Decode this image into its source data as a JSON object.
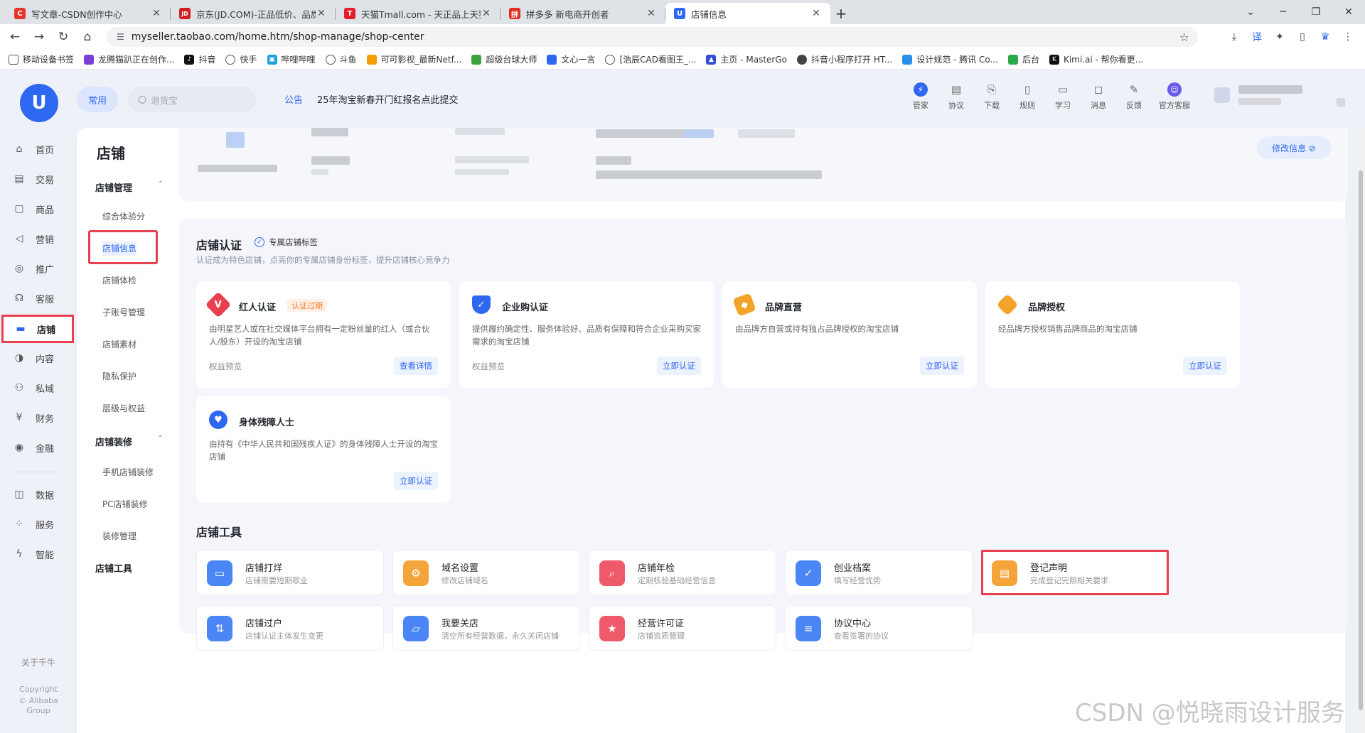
{
  "browser": {
    "tabs": [
      {
        "title": "写文章-CSDN创作中心",
        "fav": "C",
        "color": "#e8352b"
      },
      {
        "title": "京东(JD.COM)-正品低价、品质",
        "fav": "JD",
        "color": "#d01d1d"
      },
      {
        "title": "天猫Tmall.com - 天正品上天猫",
        "fav": "T",
        "color": "#e51c2a"
      },
      {
        "title": "拼多多 新电商开创者",
        "fav": "拼",
        "color": "#e02e24"
      },
      {
        "title": "店铺信息",
        "fav": "U",
        "color": "#2f68f0"
      }
    ],
    "url": "myseller.taobao.com/home.htm/shop-manage/shop-center",
    "bookmarks": [
      {
        "label": "移动设备书签",
        "color": "#666"
      },
      {
        "label": "龙腾猫趴正在创作...",
        "color": "#7b3fd6"
      },
      {
        "label": "抖音",
        "color": "#111"
      },
      {
        "label": "快手",
        "color": "#666"
      },
      {
        "label": "哔哩哔哩",
        "color": "#1b9fe1"
      },
      {
        "label": "斗鱼",
        "color": "#666"
      },
      {
        "label": "可可影视_最新Netf...",
        "color": "#f5a000"
      },
      {
        "label": "超级台球大师",
        "color": "#3ca33c"
      },
      {
        "label": "文心一言",
        "color": "#2f68f0"
      },
      {
        "label": "[浩辰CAD看图王_...",
        "color": "#c0392b"
      },
      {
        "label": "主页 - MasterGo",
        "color": "#2f4fd6"
      },
      {
        "label": "抖音小程序打开 HT...",
        "color": "#444"
      },
      {
        "label": "设计规范 - 腾讯 Co...",
        "color": "#2a8de8"
      },
      {
        "label": "后台",
        "color": "#2aa84a"
      },
      {
        "label": "Kimi.ai - 帮你看更...",
        "color": "#111"
      }
    ]
  },
  "header": {
    "common_label": "常用",
    "search_placeholder": "退货宝",
    "notice_label": "公告",
    "notice_text": "25年淘宝新春开门红报名点此提交",
    "tools": [
      {
        "label": "管家",
        "icon": "bolt-icon"
      },
      {
        "label": "协议",
        "icon": "contract-icon"
      },
      {
        "label": "下载",
        "icon": "download-icon"
      },
      {
        "label": "规则",
        "icon": "rules-icon"
      },
      {
        "label": "学习",
        "icon": "study-icon"
      },
      {
        "label": "消息",
        "icon": "message-icon"
      },
      {
        "label": "反馈",
        "icon": "feedback-icon"
      },
      {
        "label": "官方客服",
        "icon": "service-icon"
      }
    ]
  },
  "leftnav": {
    "items": [
      {
        "label": "首页",
        "icon": "home-icon"
      },
      {
        "label": "交易",
        "icon": "trade-icon"
      },
      {
        "label": "商品",
        "icon": "goods-icon"
      },
      {
        "label": "营销",
        "icon": "marketing-icon"
      },
      {
        "label": "推广",
        "icon": "promotion-icon"
      },
      {
        "label": "客服",
        "icon": "customer-service-icon"
      },
      {
        "label": "店铺",
        "icon": "shop-icon"
      },
      {
        "label": "内容",
        "icon": "content-icon"
      },
      {
        "label": "私域",
        "icon": "private-domain-icon"
      },
      {
        "label": "财务",
        "icon": "finance-icon"
      },
      {
        "label": "金融",
        "icon": "finance-service-icon"
      },
      {
        "label": "数据",
        "icon": "data-icon"
      },
      {
        "label": "服务",
        "icon": "services-icon"
      },
      {
        "label": "智能",
        "icon": "smart-icon"
      }
    ],
    "active": "店铺",
    "about": "关于千牛",
    "copyright": "Copyright",
    "company": "© Alibaba",
    "group": "Group"
  },
  "subnav": {
    "title": "店铺",
    "group1": "店铺管理",
    "group1_items": [
      "综合体验分",
      "店铺信息",
      "店铺体检",
      "子账号管理",
      "店铺素材",
      "隐私保护",
      "层级与权益"
    ],
    "group2": "店铺装修",
    "group2_items": [
      "手机店铺装修",
      "PC店铺装修",
      "装修管理"
    ],
    "group3": "店铺工具",
    "active": "店铺信息"
  },
  "info": {
    "modify_label": "修改信息 ⊘"
  },
  "certification": {
    "title": "店铺认证",
    "tag_label": "专属店铺标签",
    "description": "认证成为特色店铺，点亮你的专属店铺身份标签，提升店铺核心竞争力",
    "cards": [
      {
        "title": "红人认证",
        "badge": "认证过期",
        "desc": "由明星艺人或在社交媒体平台拥有一定粉丝量的红人（或合伙人/股东）开设的淘宝店铺",
        "foot": "权益预览",
        "button": "查看详情",
        "icon": "red-influencer-icon",
        "color": "#e8404f"
      },
      {
        "title": "企业购认证",
        "badge": "",
        "desc": "提供履约确定性、服务体验好、品质有保障和符合企业采购买家需求的淘宝店铺",
        "foot": "权益预览",
        "button": "立即认证",
        "icon": "enterprise-shield-icon",
        "color": "#2f68f0"
      },
      {
        "title": "品牌直营",
        "badge": "",
        "desc": "由品牌方自营或持有独占品牌授权的淘宝店铺",
        "foot": "",
        "button": "立即认证",
        "icon": "brand-tag-icon",
        "color": "#f4a32a"
      },
      {
        "title": "品牌授权",
        "badge": "",
        "desc": "经品牌方授权销售品牌商品的淘宝店铺",
        "foot": "",
        "button": "立即认证",
        "icon": "brand-diamond-icon",
        "color": "#f4a32a"
      },
      {
        "title": "身体残障人士",
        "badge": "",
        "desc": "由持有《中华人民共和国残疾人证》的身体残障人士开设的淘宝店铺",
        "foot": "",
        "button": "立即认证",
        "icon": "heart-hand-icon",
        "color": "#2f68f0"
      }
    ]
  },
  "tools": {
    "title": "店铺工具",
    "items": [
      {
        "name": "店铺打烊",
        "desc": "店铺需要短期歇业",
        "icon": "shop-closed-icon",
        "color": "#4a86f5"
      },
      {
        "name": "域名设置",
        "desc": "修改店铺域名",
        "icon": "domain-icon",
        "color": "#f5a43a"
      },
      {
        "name": "店铺年检",
        "desc": "定期核验基础经营信息",
        "icon": "annual-inspection-icon",
        "color": "#ee5a6a"
      },
      {
        "name": "创业档案",
        "desc": "填写经营优势",
        "icon": "archive-icon",
        "color": "#4a86f5"
      },
      {
        "name": "登记声明",
        "desc": "完成登记完照相关要求",
        "icon": "registration-icon",
        "color": "#f5a43a"
      },
      {
        "name": "店铺过户",
        "desc": "店铺认证主体发生变更",
        "icon": "transfer-icon",
        "color": "#4a86f5"
      },
      {
        "name": "我要关店",
        "desc": "清空所有经营数据，永久关闭店铺",
        "icon": "close-shop-icon",
        "color": "#4a86f5"
      },
      {
        "name": "经营许可证",
        "desc": "店铺资质管理",
        "icon": "license-icon",
        "color": "#ee5a6a"
      },
      {
        "name": "协议中心",
        "desc": "查看签署的协议",
        "icon": "agreement-icon",
        "color": "#4a86f5"
      }
    ]
  },
  "watermark": "CSDN @悦晓雨设计服务"
}
